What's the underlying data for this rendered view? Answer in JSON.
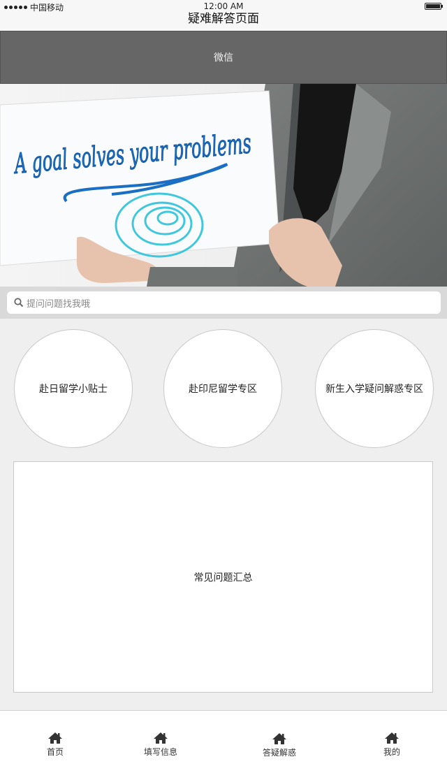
{
  "status_bar": {
    "carrier": "中国移动",
    "time": "12:00 AM"
  },
  "page": {
    "title": "疑难解答页面"
  },
  "header": {
    "label": "微信"
  },
  "banner": {
    "slogan": "A goal solves your problems"
  },
  "search": {
    "placeholder": "提问问题找我哦"
  },
  "categories": [
    {
      "label": "赴日留学小贴士"
    },
    {
      "label": "赴印尼留学专区"
    },
    {
      "label": "新生入学疑问解惑专区"
    }
  ],
  "faq": {
    "label": "常见问题汇总"
  },
  "tabs": [
    {
      "label": "首页",
      "icon": "home-icon"
    },
    {
      "label": "填写信息",
      "icon": "home-icon"
    },
    {
      "label": "答疑解惑",
      "icon": "home-icon"
    },
    {
      "label": "我的",
      "icon": "home-icon"
    }
  ],
  "colors": {
    "header_bg": "#666666",
    "page_bg": "#efeff0",
    "slogan_blue": "#1a6fc4"
  }
}
